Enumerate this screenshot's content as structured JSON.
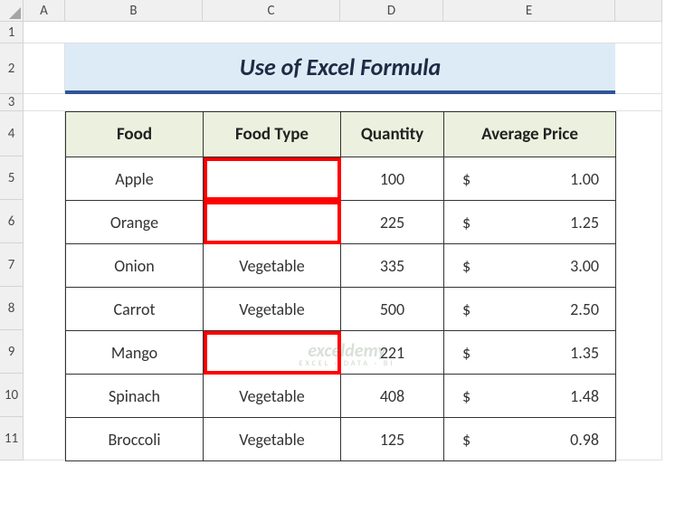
{
  "columns": [
    "A",
    "B",
    "C",
    "D",
    "E"
  ],
  "rows": [
    "1",
    "2",
    "3",
    "4",
    "5",
    "6",
    "7",
    "8",
    "9",
    "10",
    "11"
  ],
  "title": "Use of Excel Formula",
  "headers": [
    "Food",
    "Food Type",
    "Quantity",
    "Average Price"
  ],
  "currency": "$",
  "data": [
    {
      "food": "Apple",
      "type": "",
      "qty": "100",
      "price": "1.00",
      "hl": true
    },
    {
      "food": "Orange",
      "type": "",
      "qty": "225",
      "price": "1.25",
      "hl": true
    },
    {
      "food": "Onion",
      "type": "Vegetable",
      "qty": "335",
      "price": "3.00",
      "hl": false
    },
    {
      "food": "Carrot",
      "type": "Vegetable",
      "qty": "500",
      "price": "2.50",
      "hl": false
    },
    {
      "food": "Mango",
      "type": "",
      "qty": "221",
      "price": "1.35",
      "hl": true
    },
    {
      "food": "Spinach",
      "type": "Vegetable",
      "qty": "408",
      "price": "1.48",
      "hl": false
    },
    {
      "food": "Broccoli",
      "type": "Vegetable",
      "qty": "125",
      "price": "0.98",
      "hl": false
    }
  ],
  "watermark": {
    "main": "exceldemy",
    "sub": "EXCEL · DATA · BI"
  }
}
